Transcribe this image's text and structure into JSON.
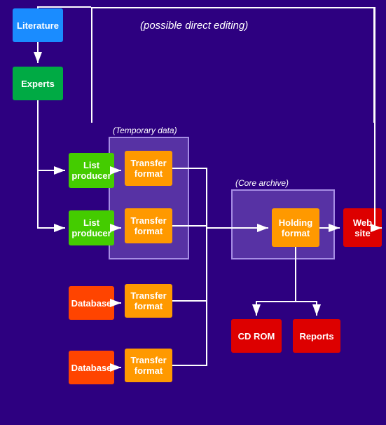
{
  "boxes": {
    "literature": "Literature",
    "experts": "Experts",
    "list_producer_1": "List producer",
    "list_producer_2": "List producer",
    "transfer_format_1": "Transfer format",
    "transfer_format_2": "Transfer format",
    "transfer_format_3": "Transfer format",
    "transfer_format_4": "Transfer format",
    "holding_format": "Holding format",
    "website": "Web site",
    "database_1": "Database",
    "database_2": "Database",
    "cdrom": "CD ROM",
    "reports": "Reports"
  },
  "labels": {
    "possible_direct_editing": "(possible direct editing)",
    "temporary_data": "(Temporary data)",
    "core_archive": "(Core archive)"
  }
}
